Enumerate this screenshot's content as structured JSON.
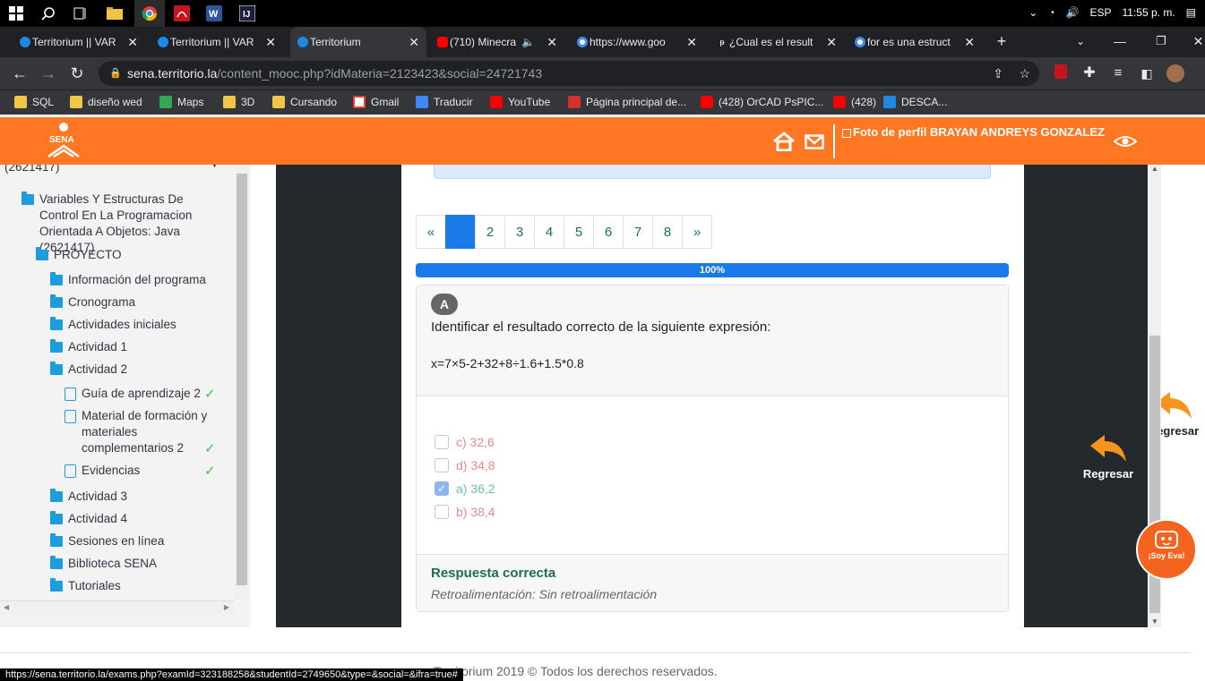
{
  "taskbar": {
    "lang": "ESP",
    "time": "11:55 p. m."
  },
  "tabs": [
    {
      "label": "Territorium || VAR",
      "icon": "eye-icon"
    },
    {
      "label": "Territorium || VAR",
      "icon": "eye-icon"
    },
    {
      "label": "Territorium",
      "icon": "eye-icon",
      "active": true
    },
    {
      "label": "(710) Minecra",
      "icon": "youtube-icon"
    },
    {
      "label": "https://www.goo",
      "icon": "google-icon"
    },
    {
      "label": "¿Cual es el result",
      "icon": "brainly-icon"
    },
    {
      "label": "for es una estruct",
      "icon": "google-icon"
    }
  ],
  "address": {
    "host": "sena.territorio.la",
    "path": "/content_mooc.php?idMateria=2123423&social=24721743"
  },
  "bookmarks": [
    "SQL",
    "diseño wed",
    "Maps",
    "3D",
    "Cursando",
    "Gmail",
    "Traducir",
    "YouTube",
    "Página principal de...",
    "(428) OrCAD PsPIC...",
    "(428)",
    "DESCA..."
  ],
  "header": {
    "profile_alt": "Foto de perfil BRAYAN ANDREYS GONZALEZ"
  },
  "sidebar": {
    "top_partial": "(2621417)",
    "course": "Variables Y Estructuras De Control En La Programacion Orientada A Objetos: Java (2621417)",
    "project": "PROYECTO",
    "items": [
      {
        "label": "Información del programa"
      },
      {
        "label": "Cronograma"
      },
      {
        "label": "Actividades iniciales"
      },
      {
        "label": "Actividad 1"
      },
      {
        "label": "Actividad 2"
      }
    ],
    "subitems": [
      {
        "label": "Guía de aprendizaje 2"
      },
      {
        "label": "Material de formación y materiales complementarios 2"
      },
      {
        "label": "Evidencias"
      }
    ],
    "items2": [
      {
        "label": "Actividad 3"
      },
      {
        "label": "Actividad 4"
      },
      {
        "label": "Sesiones en línea"
      },
      {
        "label": "Biblioteca SENA"
      },
      {
        "label": "Tutoriales"
      }
    ]
  },
  "pagination": {
    "prev": "«",
    "pages": [
      "1",
      "2",
      "3",
      "4",
      "5",
      "6",
      "7",
      "8"
    ],
    "next": "»",
    "active": 1
  },
  "progress": {
    "value": 1.0,
    "label": "100%"
  },
  "question": {
    "badge": "A",
    "text": "Identificar el resultado correcto de la siguiente expresión:",
    "expression": "x=7×5-2+32+8÷1.6+1.5*0.8",
    "options": [
      {
        "label": "c) 32,6",
        "checked": false
      },
      {
        "label": "d) 34,8",
        "checked": false
      },
      {
        "label": "a) 36,2",
        "checked": true
      },
      {
        "label": "b) 38,4",
        "checked": false
      }
    ],
    "result": "Respuesta correcta",
    "feedback": "Retroalimentación: Sin retroalimentación"
  },
  "back_label": "Regresar",
  "eva_label": "¡Soy Eva!",
  "footer": "Territorium 2019 © Todos los derechos reservados.",
  "status_url": "https://sena.territorio.la/exams.php?examId=323188258&studentId=2749650&type=&social=&ifra=true#"
}
